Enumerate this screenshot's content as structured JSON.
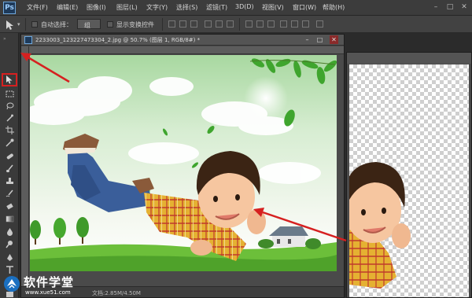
{
  "app": {
    "logo": "Ps"
  },
  "menu": [
    "文件(F)",
    "编辑(E)",
    "图像(I)",
    "图层(L)",
    "文字(Y)",
    "选择(S)",
    "滤镜(T)",
    "3D(D)",
    "视图(V)",
    "窗口(W)",
    "帮助(H)"
  ],
  "window_controls": {
    "minimize": "–",
    "maximize": "□",
    "close": "✕"
  },
  "options": {
    "auto_select_label": "自动选择：",
    "auto_select_value": "组",
    "show_transform_label": "显示变换控件"
  },
  "document": {
    "title": "2233003_123227473304_2.jpg @ 50.7% (图层 1, RGB/8#) *",
    "status": "文档:2.85M/4.50M"
  },
  "watermark": {
    "brand": "软件学堂",
    "url": "www.xue51.com"
  },
  "icons": {
    "move_tool": "move-arrow-icon",
    "marquee": "marquee-icon",
    "lasso": "lasso-icon",
    "quick_select": "wand-icon",
    "crop": "crop-icon",
    "eyedropper": "eyedropper-icon",
    "heal": "bandage-icon",
    "brush": "brush-icon",
    "stamp": "stamp-icon",
    "history": "history-brush-icon",
    "eraser": "eraser-icon",
    "gradient": "gradient-icon",
    "blur": "blur-icon",
    "dodge": "dodge-icon",
    "pen": "pen-icon",
    "type": "type-icon",
    "path_select": "path-select-icon",
    "shape": "rectangle-shape-icon",
    "hand": "hand-icon",
    "zoom": "zoom-icon"
  },
  "colors": {
    "annotation": "#d62020",
    "ui_dark": "#3c3c3c",
    "ps_blue": "#1e3a5a"
  }
}
